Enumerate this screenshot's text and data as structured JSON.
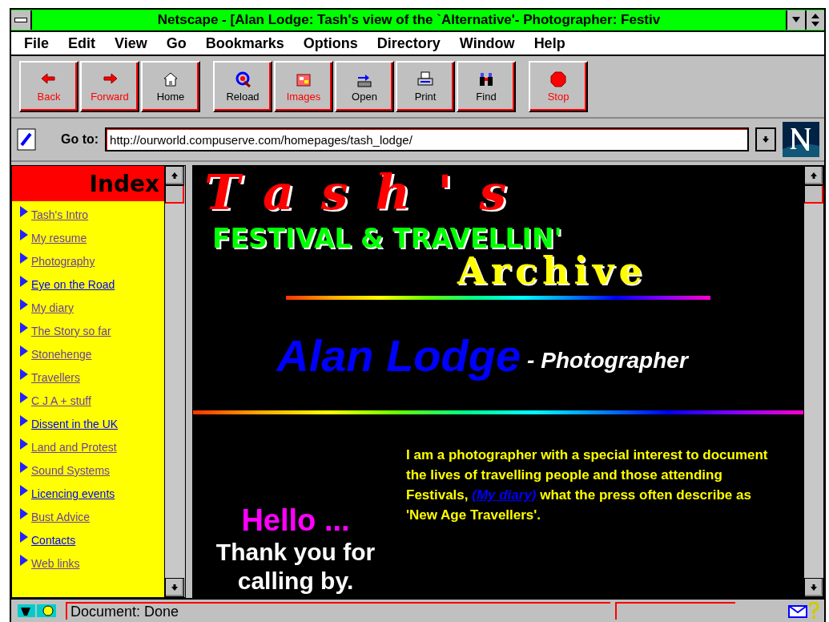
{
  "window": {
    "title": "Netscape - [Alan Lodge: Tash's view of the `Alternative'- Photographer: Festiv"
  },
  "menu": [
    "File",
    "Edit",
    "View",
    "Go",
    "Bookmarks",
    "Options",
    "Directory",
    "Window",
    "Help"
  ],
  "toolbar": [
    [
      {
        "label": "Back",
        "kind": "back",
        "accent": true
      },
      {
        "label": "Forward",
        "kind": "forward",
        "accent": true
      },
      {
        "label": "Home",
        "kind": "home",
        "accent": false
      }
    ],
    [
      {
        "label": "Reload",
        "kind": "reload",
        "accent": false
      },
      {
        "label": "Images",
        "kind": "images",
        "accent": true
      },
      {
        "label": "Open",
        "kind": "open",
        "accent": false
      },
      {
        "label": "Print",
        "kind": "print",
        "accent": false
      },
      {
        "label": "Find",
        "kind": "find",
        "accent": false
      }
    ],
    [
      {
        "label": "Stop",
        "kind": "stop",
        "accent": true
      }
    ]
  ],
  "location": {
    "label": "Go to:",
    "value": "http://ourworld.compuserve.com/homepages/tash_lodge/"
  },
  "index": {
    "title": "Index",
    "links": [
      {
        "label": "Tash's Intro",
        "visited": true
      },
      {
        "label": "My resume",
        "visited": true
      },
      {
        "label": "Photography",
        "visited": true
      },
      {
        "label": "Eye on the Road",
        "visited": false
      },
      {
        "label": "My diary",
        "visited": true
      },
      {
        "label": "The Story so far",
        "visited": true
      },
      {
        "label": "Stonehenge",
        "visited": true
      },
      {
        "label": "Travellers",
        "visited": true
      },
      {
        "label": "C J A + stuff",
        "visited": true
      },
      {
        "label": "Dissent in the UK",
        "visited": false
      },
      {
        "label": "Land and Protest",
        "visited": true
      },
      {
        "label": "Sound Systems",
        "visited": true
      },
      {
        "label": "Licencing events",
        "visited": false
      },
      {
        "label": "Bust Advice",
        "visited": true
      },
      {
        "label": "Contacts",
        "visited": false
      },
      {
        "label": "Web links",
        "visited": true
      }
    ]
  },
  "page": {
    "logo": {
      "title": "Tash's",
      "subtitle": "FESTIVAL & TRAVELLIN'",
      "archive": "Archive"
    },
    "name": "Alan Lodge",
    "role": "- Photographer",
    "greeting": "Hello ...",
    "thanks": "Thank you for calling by.",
    "intro": "I am a photographer with a special interest to document the lives of travelling people and those attending Festivals,",
    "intro_link": "(My diary)",
    "intro_end": "what the press often describe as 'New Age Travellers'."
  },
  "status_bar": {
    "text": "Document: Done"
  }
}
